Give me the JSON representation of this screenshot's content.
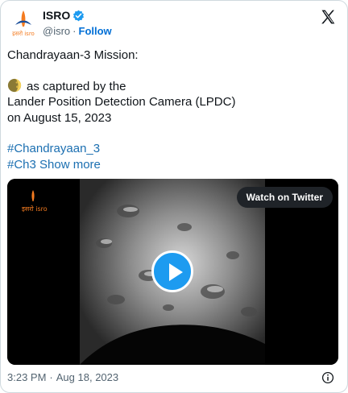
{
  "header": {
    "logo_text": "इसरो isro",
    "name": "ISRO",
    "handle": "@isro",
    "separator": "·",
    "follow_label": "Follow"
  },
  "tweet": {
    "line1": "Chandrayaan-3 Mission:",
    "line2": "as captured by the",
    "line3": "Lander Position Detection Camera (LPDC)",
    "line4": "on August 15, 2023",
    "hashtag1": "#Chandrayaan_3",
    "hashtag2": "#Ch3",
    "show_more": "Show more"
  },
  "media": {
    "watch_label": "Watch on Twitter",
    "overlay_logo_text": "इसरो isro"
  },
  "footer": {
    "time": "3:23 PM",
    "separator": "·",
    "date": "Aug 18, 2023"
  },
  "colors": {
    "link": "#1b6fb1",
    "follow": "#006fd6",
    "verified": "#1d9bf0",
    "play": "#1d9bf0"
  }
}
